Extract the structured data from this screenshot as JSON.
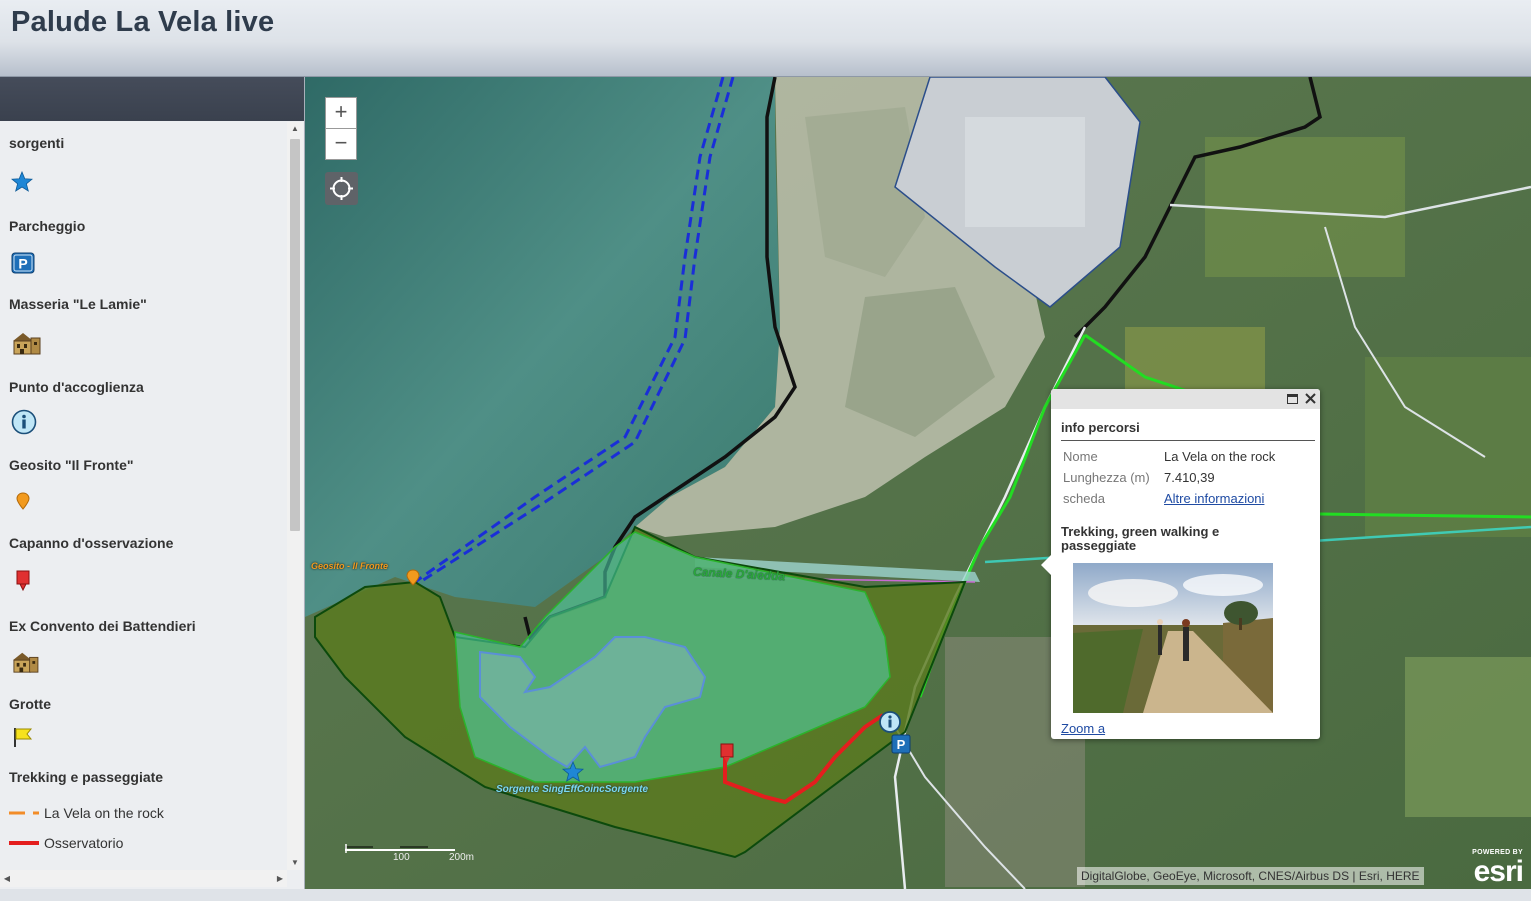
{
  "header": {
    "title": "Palude La Vela live"
  },
  "legend": {
    "layers": [
      {
        "title": "sorgenti",
        "icon": "star-icon"
      },
      {
        "title": "Parcheggio",
        "icon": "parking-icon"
      },
      {
        "title": "Masseria \"Le Lamie\"",
        "icon": "building-icon"
      },
      {
        "title": "Punto d'accoglienza",
        "icon": "info-icon"
      },
      {
        "title": "Geosito \"Il Fronte\"",
        "icon": "orange-marker-icon"
      },
      {
        "title": "Capanno d'osservazione",
        "icon": "red-marker-icon"
      },
      {
        "title": "Ex Convento dei Battendieri",
        "icon": "building-icon"
      },
      {
        "title": "Grotte",
        "icon": "yellow-flag-icon"
      },
      {
        "title": "Trekking e passeggiate",
        "icon": ""
      }
    ],
    "trails": [
      {
        "label": "La Vela on the rock",
        "color": "#f28c28",
        "style": "dashed"
      },
      {
        "label": "Osservatorio",
        "color": "#e41e1e",
        "style": "solid"
      }
    ]
  },
  "map": {
    "zoom_in": "+",
    "zoom_out": "−",
    "labels": {
      "geosito": "Geosito - Il Fronte",
      "canale": "Canale D'aiedda",
      "sorgente": "Sorgente SingEffCoincSorgente"
    },
    "scale": {
      "mid": "100",
      "end": "200m"
    },
    "attribution": "DigitalGlobe, GeoEye, Microsoft, CNES/Airbus DS | Esri, HERE",
    "esri": {
      "powered": "POWERED BY",
      "logo": "esri"
    }
  },
  "popup": {
    "title": "info percorsi",
    "fields": [
      {
        "key": "Nome",
        "value": "La Vela on the rock"
      },
      {
        "key": "Lunghezza (m)",
        "value": "7.410,39"
      },
      {
        "key": "scheda",
        "value": "Altre informazioni"
      }
    ],
    "description": "Trekking, green walking e passeggiate",
    "zoom_link": "Zoom a"
  },
  "colors": {
    "accent_dark": "#3a414e",
    "trail_orange": "#f28c28",
    "trail_red": "#e41e1e",
    "link": "#1f4ba3"
  }
}
